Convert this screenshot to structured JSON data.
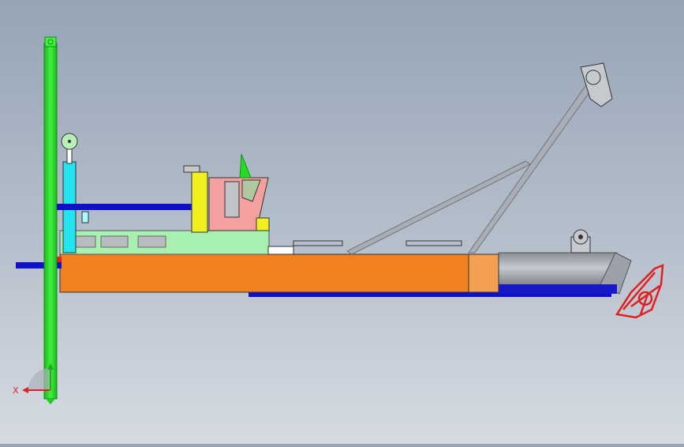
{
  "viewport": {
    "background_top": "#96a4b6",
    "background_bottom": "#d6dbe2"
  },
  "colors": {
    "hull": "#f08020",
    "hull_end": "#f5a050",
    "spud_pole": "#22dd22",
    "pipe_blue": "#1010c8",
    "cyan_cylinder": "#22e5f0",
    "yellow_post": "#f0f020",
    "cabin": "#f5a0a0",
    "deck_house": "#a8f0b0",
    "boom_grey": "#a9aeb6",
    "cutter_red": "#e02020",
    "ladder_grey": "#8c9098"
  },
  "triad": {
    "x_label": "X",
    "x_arrow_color": "#e02020",
    "y_arrow_color": "#22aa22"
  }
}
